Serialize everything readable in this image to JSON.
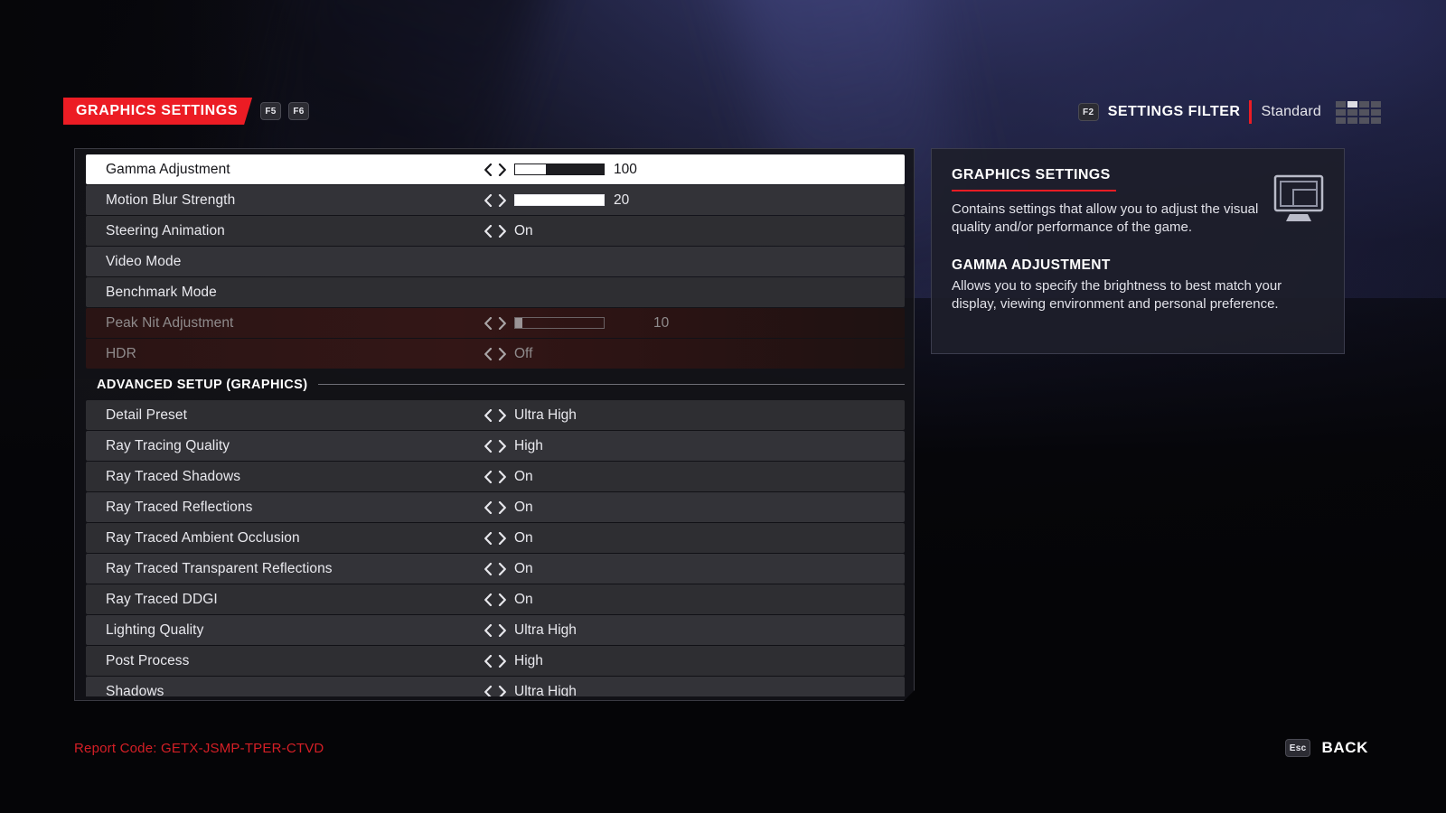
{
  "header": {
    "title": "GRAPHICS SETTINGS",
    "title_keys": [
      "F5",
      "F6"
    ],
    "filter_key": "F2",
    "filter_label": "SETTINGS FILTER",
    "filter_value": "Standard",
    "accent_color": "#ec1c24"
  },
  "settings": {
    "rows": [
      {
        "label": "Gamma Adjustment",
        "type": "slider",
        "value": "100",
        "fill_pct": 35,
        "state": "selected"
      },
      {
        "label": "Motion Blur Strength",
        "type": "slider",
        "value": "20",
        "fill_pct": 100,
        "state": "normal"
      },
      {
        "label": "Steering Animation",
        "type": "option",
        "value": "On",
        "state": "normal"
      },
      {
        "label": "Video Mode",
        "type": "submenu",
        "value": "",
        "state": "normal"
      },
      {
        "label": "Benchmark Mode",
        "type": "submenu",
        "value": "",
        "state": "normal"
      },
      {
        "label": "Peak Nit Adjustment",
        "type": "slider",
        "value": "10",
        "fill_pct": 8,
        "state": "disabled"
      },
      {
        "label": "HDR",
        "type": "option",
        "value": "Off",
        "state": "disabled"
      },
      {
        "label": "ADVANCED SETUP (GRAPHICS)",
        "type": "section"
      },
      {
        "label": "Detail Preset",
        "type": "option",
        "value": "Ultra High",
        "state": "normal"
      },
      {
        "label": "Ray Tracing Quality",
        "type": "option",
        "value": "High",
        "state": "normal"
      },
      {
        "label": "Ray Traced Shadows",
        "type": "option",
        "value": "On",
        "state": "normal"
      },
      {
        "label": "Ray Traced Reflections",
        "type": "option",
        "value": "On",
        "state": "normal"
      },
      {
        "label": "Ray Traced Ambient Occlusion",
        "type": "option",
        "value": "On",
        "state": "normal"
      },
      {
        "label": "Ray Traced Transparent Reflections",
        "type": "option",
        "value": "On",
        "state": "normal"
      },
      {
        "label": "Ray Traced DDGI",
        "type": "option",
        "value": "On",
        "state": "normal"
      },
      {
        "label": "Lighting Quality",
        "type": "option",
        "value": "Ultra High",
        "state": "normal"
      },
      {
        "label": "Post Process",
        "type": "option",
        "value": "High",
        "state": "normal"
      },
      {
        "label": "Shadows",
        "type": "option",
        "value": "Ultra High",
        "state": "normal"
      }
    ]
  },
  "info": {
    "title": "GRAPHICS SETTINGS",
    "description": "Contains settings that allow you to adjust the visual quality and/or performance of the game.",
    "sub_title": "GAMMA ADJUSTMENT",
    "sub_description": "Allows you to specify the brightness to best match your display, viewing environment and personal preference.",
    "icon": "monitor-icon"
  },
  "footer": {
    "report_code": "Report Code: GETX-JSMP-TPER-CTVD",
    "back_key": "Esc",
    "back_label": "BACK"
  }
}
